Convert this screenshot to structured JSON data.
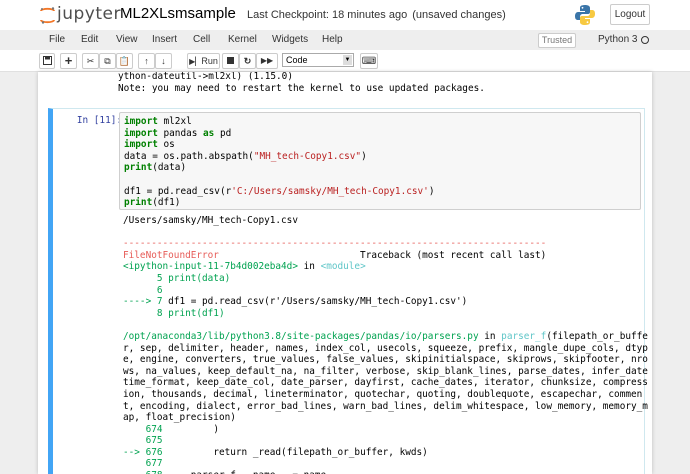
{
  "header": {
    "logo_text": "jupyter",
    "notebook_title": "ML2XLsmsample",
    "checkpoint": "Last Checkpoint: 18 minutes ago",
    "unsaved": "(unsaved changes)",
    "logout_label": "Logout"
  },
  "menu": {
    "items": [
      "File",
      "Edit",
      "View",
      "Insert",
      "Cell",
      "Kernel",
      "Widgets",
      "Help"
    ],
    "trusted_label": "Trusted",
    "kernel_name": "Python 3"
  },
  "toolbar": {
    "run_label": "Run",
    "cell_type": "Code"
  },
  "previous_output": {
    "line1": "ython-dateutil->ml2xl) (1.15.0)",
    "line2": "Note: you may need to restart the kernel to use updated packages."
  },
  "cell": {
    "prompt": "In [11]:",
    "code": [
      {
        "parts": [
          {
            "t": "import",
            "c": "kw"
          },
          {
            "t": " ml2xl",
            "c": ""
          }
        ]
      },
      {
        "parts": [
          {
            "t": "import",
            "c": "kw"
          },
          {
            "t": " pandas ",
            "c": ""
          },
          {
            "t": "as",
            "c": "kw"
          },
          {
            "t": " pd",
            "c": ""
          }
        ]
      },
      {
        "parts": [
          {
            "t": "import",
            "c": "kw"
          },
          {
            "t": " os",
            "c": ""
          }
        ]
      },
      {
        "parts": [
          {
            "t": "data = os.path.abspath(",
            "c": ""
          },
          {
            "t": "\"MH_tech-Copy1.csv\"",
            "c": "str"
          },
          {
            "t": ")",
            "c": ""
          }
        ]
      },
      {
        "parts": [
          {
            "t": "print",
            "c": "kw"
          },
          {
            "t": "(data)",
            "c": ""
          }
        ]
      },
      {
        "parts": [
          {
            "t": "",
            "c": ""
          }
        ]
      },
      {
        "parts": [
          {
            "t": "df1 = pd.read_csv(r",
            "c": ""
          },
          {
            "t": "'C:/Users/samsky/MH_tech-Copy1.csv'",
            "c": "str"
          },
          {
            "t": ")",
            "c": ""
          }
        ]
      },
      {
        "parts": [
          {
            "t": "print",
            "c": "kw"
          },
          {
            "t": "(df1)",
            "c": ""
          }
        ]
      }
    ],
    "output": [
      {
        "parts": [
          {
            "t": "/Users/samsky/MH_tech-Copy1.csv",
            "c": ""
          }
        ]
      },
      {
        "parts": [
          {
            "t": "",
            "c": ""
          }
        ]
      },
      {
        "parts": [
          {
            "t": "---------------------------------------------------------------------------",
            "c": "err"
          }
        ]
      },
      {
        "parts": [
          {
            "t": "FileNotFoundError",
            "c": "err"
          },
          {
            "t": "                         Traceback (most recent call last)",
            "c": ""
          }
        ]
      },
      {
        "parts": [
          {
            "t": "<ipython-input-11-7b4d002eba4d>",
            "c": "grn"
          },
          {
            "t": " in ",
            "c": ""
          },
          {
            "t": "<module>",
            "c": "cyn"
          }
        ]
      },
      {
        "parts": [
          {
            "t": "      5 print(data)",
            "c": "grn"
          }
        ]
      },
      {
        "parts": [
          {
            "t": "      6",
            "c": "grn"
          }
        ]
      },
      {
        "parts": [
          {
            "t": "----> 7",
            "c": "grn"
          },
          {
            "t": " df1 = pd.read_csv(r'/Users/samsky/MH_tech-Copy1.csv')",
            "c": ""
          }
        ]
      },
      {
        "parts": [
          {
            "t": "      8 print(df1)",
            "c": "grn"
          }
        ]
      },
      {
        "parts": [
          {
            "t": "",
            "c": ""
          }
        ]
      },
      {
        "parts": [
          {
            "t": "/opt/anaconda3/lib/python3.8/site-packages/pandas/io/parsers.py",
            "c": "grn"
          },
          {
            "t": " in ",
            "c": ""
          },
          {
            "t": "parser_f",
            "c": "cyn"
          },
          {
            "t": "(filepath_or_buffe",
            "c": ""
          }
        ]
      },
      {
        "parts": [
          {
            "t": "r, sep, delimiter, header, names, index_col, usecols, squeeze, prefix, mangle_dupe_cols, dtyp",
            "c": ""
          }
        ]
      },
      {
        "parts": [
          {
            "t": "e, engine, converters, true_values, false_values, skipinitialspace, skiprows, skipfooter, nro",
            "c": ""
          }
        ]
      },
      {
        "parts": [
          {
            "t": "ws, na_values, keep_default_na, na_filter, verbose, skip_blank_lines, parse_dates, infer_date",
            "c": ""
          }
        ]
      },
      {
        "parts": [
          {
            "t": "time_format, keep_date_col, date_parser, dayfirst, cache_dates, iterator, chunksize, compress",
            "c": ""
          }
        ]
      },
      {
        "parts": [
          {
            "t": "ion, thousands, decimal, lineterminator, quotechar, quoting, doublequote, escapechar, commen",
            "c": ""
          }
        ]
      },
      {
        "parts": [
          {
            "t": "t, encoding, dialect, error_bad_lines, warn_bad_lines, delim_whitespace, low_memory, memory_m",
            "c": ""
          }
        ]
      },
      {
        "parts": [
          {
            "t": "ap, float_precision)",
            "c": ""
          }
        ]
      },
      {
        "parts": [
          {
            "t": "    674",
            "c": "grn"
          },
          {
            "t": "         )",
            "c": ""
          }
        ]
      },
      {
        "parts": [
          {
            "t": "    675",
            "c": "grn"
          }
        ]
      },
      {
        "parts": [
          {
            "t": "--> 676",
            "c": "grn"
          },
          {
            "t": "         return _read(filepath_or_buffer, kwds)",
            "c": ""
          }
        ]
      },
      {
        "parts": [
          {
            "t": "    677",
            "c": "grn"
          }
        ]
      },
      {
        "parts": [
          {
            "t": "    678",
            "c": "grn"
          },
          {
            "t": "     parser_f.__name__ = name",
            "c": ""
          }
        ]
      }
    ]
  }
}
